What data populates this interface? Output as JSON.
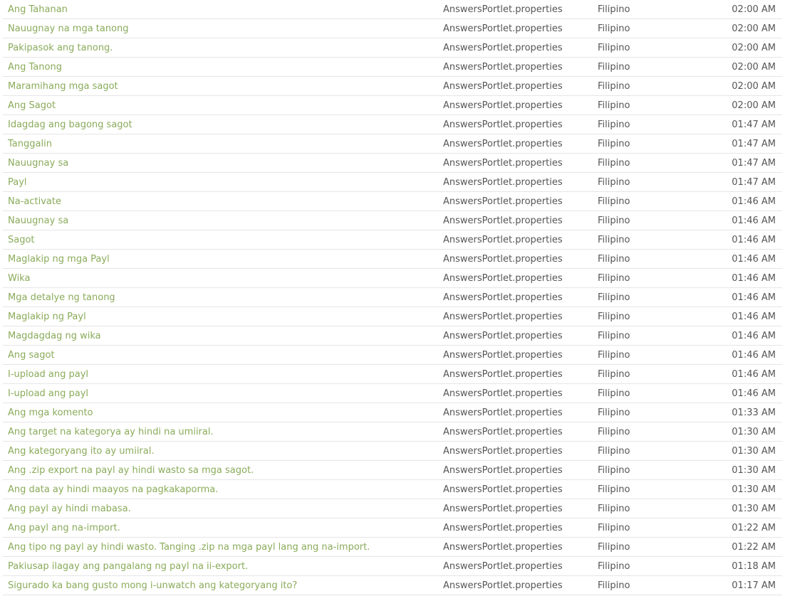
{
  "rows": [
    {
      "text": "Ang Tahanan",
      "file": "AnswersPortlet.properties",
      "language": "Filipino",
      "time": "02:00 AM"
    },
    {
      "text": "Nauugnay na mga tanong",
      "file": "AnswersPortlet.properties",
      "language": "Filipino",
      "time": "02:00 AM"
    },
    {
      "text": "Pakipasok ang tanong.",
      "file": "AnswersPortlet.properties",
      "language": "Filipino",
      "time": "02:00 AM"
    },
    {
      "text": "Ang Tanong",
      "file": "AnswersPortlet.properties",
      "language": "Filipino",
      "time": "02:00 AM"
    },
    {
      "text": "Maramihang mga sagot",
      "file": "AnswersPortlet.properties",
      "language": "Filipino",
      "time": "02:00 AM"
    },
    {
      "text": "Ang Sagot",
      "file": "AnswersPortlet.properties",
      "language": "Filipino",
      "time": "02:00 AM"
    },
    {
      "text": "Idagdag ang bagong sagot",
      "file": "AnswersPortlet.properties",
      "language": "Filipino",
      "time": "01:47 AM"
    },
    {
      "text": "Tanggalin",
      "file": "AnswersPortlet.properties",
      "language": "Filipino",
      "time": "01:47 AM"
    },
    {
      "text": "Nauugnay sa",
      "file": "AnswersPortlet.properties",
      "language": "Filipino",
      "time": "01:47 AM"
    },
    {
      "text": "Payl",
      "file": "AnswersPortlet.properties",
      "language": "Filipino",
      "time": "01:47 AM"
    },
    {
      "text": "Na-activate",
      "file": "AnswersPortlet.properties",
      "language": "Filipino",
      "time": "01:46 AM"
    },
    {
      "text": "Nauugnay sa",
      "file": "AnswersPortlet.properties",
      "language": "Filipino",
      "time": "01:46 AM"
    },
    {
      "text": "Sagot",
      "file": "AnswersPortlet.properties",
      "language": "Filipino",
      "time": "01:46 AM"
    },
    {
      "text": "Maglakip ng mga Payl",
      "file": "AnswersPortlet.properties",
      "language": "Filipino",
      "time": "01:46 AM"
    },
    {
      "text": "Wika",
      "file": "AnswersPortlet.properties",
      "language": "Filipino",
      "time": "01:46 AM"
    },
    {
      "text": "Mga detalye ng tanong",
      "file": "AnswersPortlet.properties",
      "language": "Filipino",
      "time": "01:46 AM"
    },
    {
      "text": "Maglakip ng Payl",
      "file": "AnswersPortlet.properties",
      "language": "Filipino",
      "time": "01:46 AM"
    },
    {
      "text": "Magdagdag ng wika",
      "file": "AnswersPortlet.properties",
      "language": "Filipino",
      "time": "01:46 AM"
    },
    {
      "text": "Ang sagot",
      "file": "AnswersPortlet.properties",
      "language": "Filipino",
      "time": "01:46 AM"
    },
    {
      "text": "I-upload ang payl",
      "file": "AnswersPortlet.properties",
      "language": "Filipino",
      "time": "01:46 AM"
    },
    {
      "text": "I-upload ang payl",
      "file": "AnswersPortlet.properties",
      "language": "Filipino",
      "time": "01:46 AM"
    },
    {
      "text": "Ang mga komento",
      "file": "AnswersPortlet.properties",
      "language": "Filipino",
      "time": "01:33 AM"
    },
    {
      "text": "Ang target na kategorya ay hindi na umiiral.",
      "file": "AnswersPortlet.properties",
      "language": "Filipino",
      "time": "01:30 AM"
    },
    {
      "text": "Ang kategoryang ito ay umiiral.",
      "file": "AnswersPortlet.properties",
      "language": "Filipino",
      "time": "01:30 AM"
    },
    {
      "text": "Ang .zip export na payl ay hindi wasto sa mga sagot.",
      "file": "AnswersPortlet.properties",
      "language": "Filipino",
      "time": "01:30 AM"
    },
    {
      "text": "Ang data ay hindi maayos na pagkakaporma.",
      "file": "AnswersPortlet.properties",
      "language": "Filipino",
      "time": "01:30 AM"
    },
    {
      "text": "Ang payl ay hindi mabasa.",
      "file": "AnswersPortlet.properties",
      "language": "Filipino",
      "time": "01:30 AM"
    },
    {
      "text": "Ang payl ang na-import.",
      "file": "AnswersPortlet.properties",
      "language": "Filipino",
      "time": "01:22 AM"
    },
    {
      "text": "Ang tipo ng payl ay hindi wasto. Tanging .zip na mga payl lang ang na-import.",
      "file": "AnswersPortlet.properties",
      "language": "Filipino",
      "time": "01:22 AM"
    },
    {
      "text": "Pakiusap ilagay ang pangalang ng payl na ii-export.",
      "file": "AnswersPortlet.properties",
      "language": "Filipino",
      "time": "01:18 AM"
    },
    {
      "text": "Sigurado ka bang gusto mong i-unwatch ang kategoryang ito?",
      "file": "AnswersPortlet.properties",
      "language": "Filipino",
      "time": "01:17 AM"
    }
  ]
}
